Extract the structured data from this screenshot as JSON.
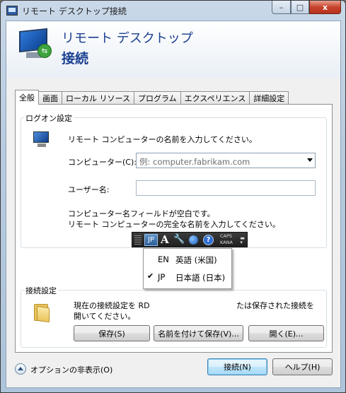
{
  "window": {
    "title": "リモート デスクトップ接続",
    "minimize_glyph": "–",
    "maximize_glyph": "□",
    "close_glyph": "x"
  },
  "header": {
    "line1": "リモート デスクトップ",
    "line2": "接続"
  },
  "tabs": [
    "全般",
    "画面",
    "ローカル リソース",
    "プログラム",
    "エクスペリエンス",
    "詳細設定"
  ],
  "logon": {
    "legend": "ログオン設定",
    "instruction": "リモート コンピューターの名前を入力してください。",
    "computer_label": "コンピューター(C):",
    "computer_placeholder": "例: computer.fabrikam.com",
    "user_label": "ユーザー名:",
    "user_value": "",
    "note_line1": "コンピューター名フィールドが空白です。",
    "note_line2": "リモート コンピューターの完全な名前を入力してください。"
  },
  "connection": {
    "legend": "接続設定",
    "desc_line1": "現在の接続設定を RD",
    "desc_line1_tail": "たは保存された接続を",
    "desc_line2": "開いてください。",
    "save_label": "保存(S)",
    "save_as_label": "名前を付けて保存(V)...",
    "open_label": "開く(E)..."
  },
  "language_bar": {
    "active_input": "JP",
    "ime_glyph": "A",
    "caps": "CAPS",
    "kana": "KANA",
    "help_glyph": "?",
    "menu": [
      {
        "code": "EN",
        "name": "英語 (米国)",
        "checked": false,
        "check_glyph": ""
      },
      {
        "code": "JP",
        "name": "日本語 (日本)",
        "checked": true,
        "check_glyph": "✔"
      }
    ]
  },
  "footer": {
    "options_label": "オプションの非表示(O)",
    "connect_label": "接続(N)",
    "help_label": "ヘルプ(H)"
  }
}
